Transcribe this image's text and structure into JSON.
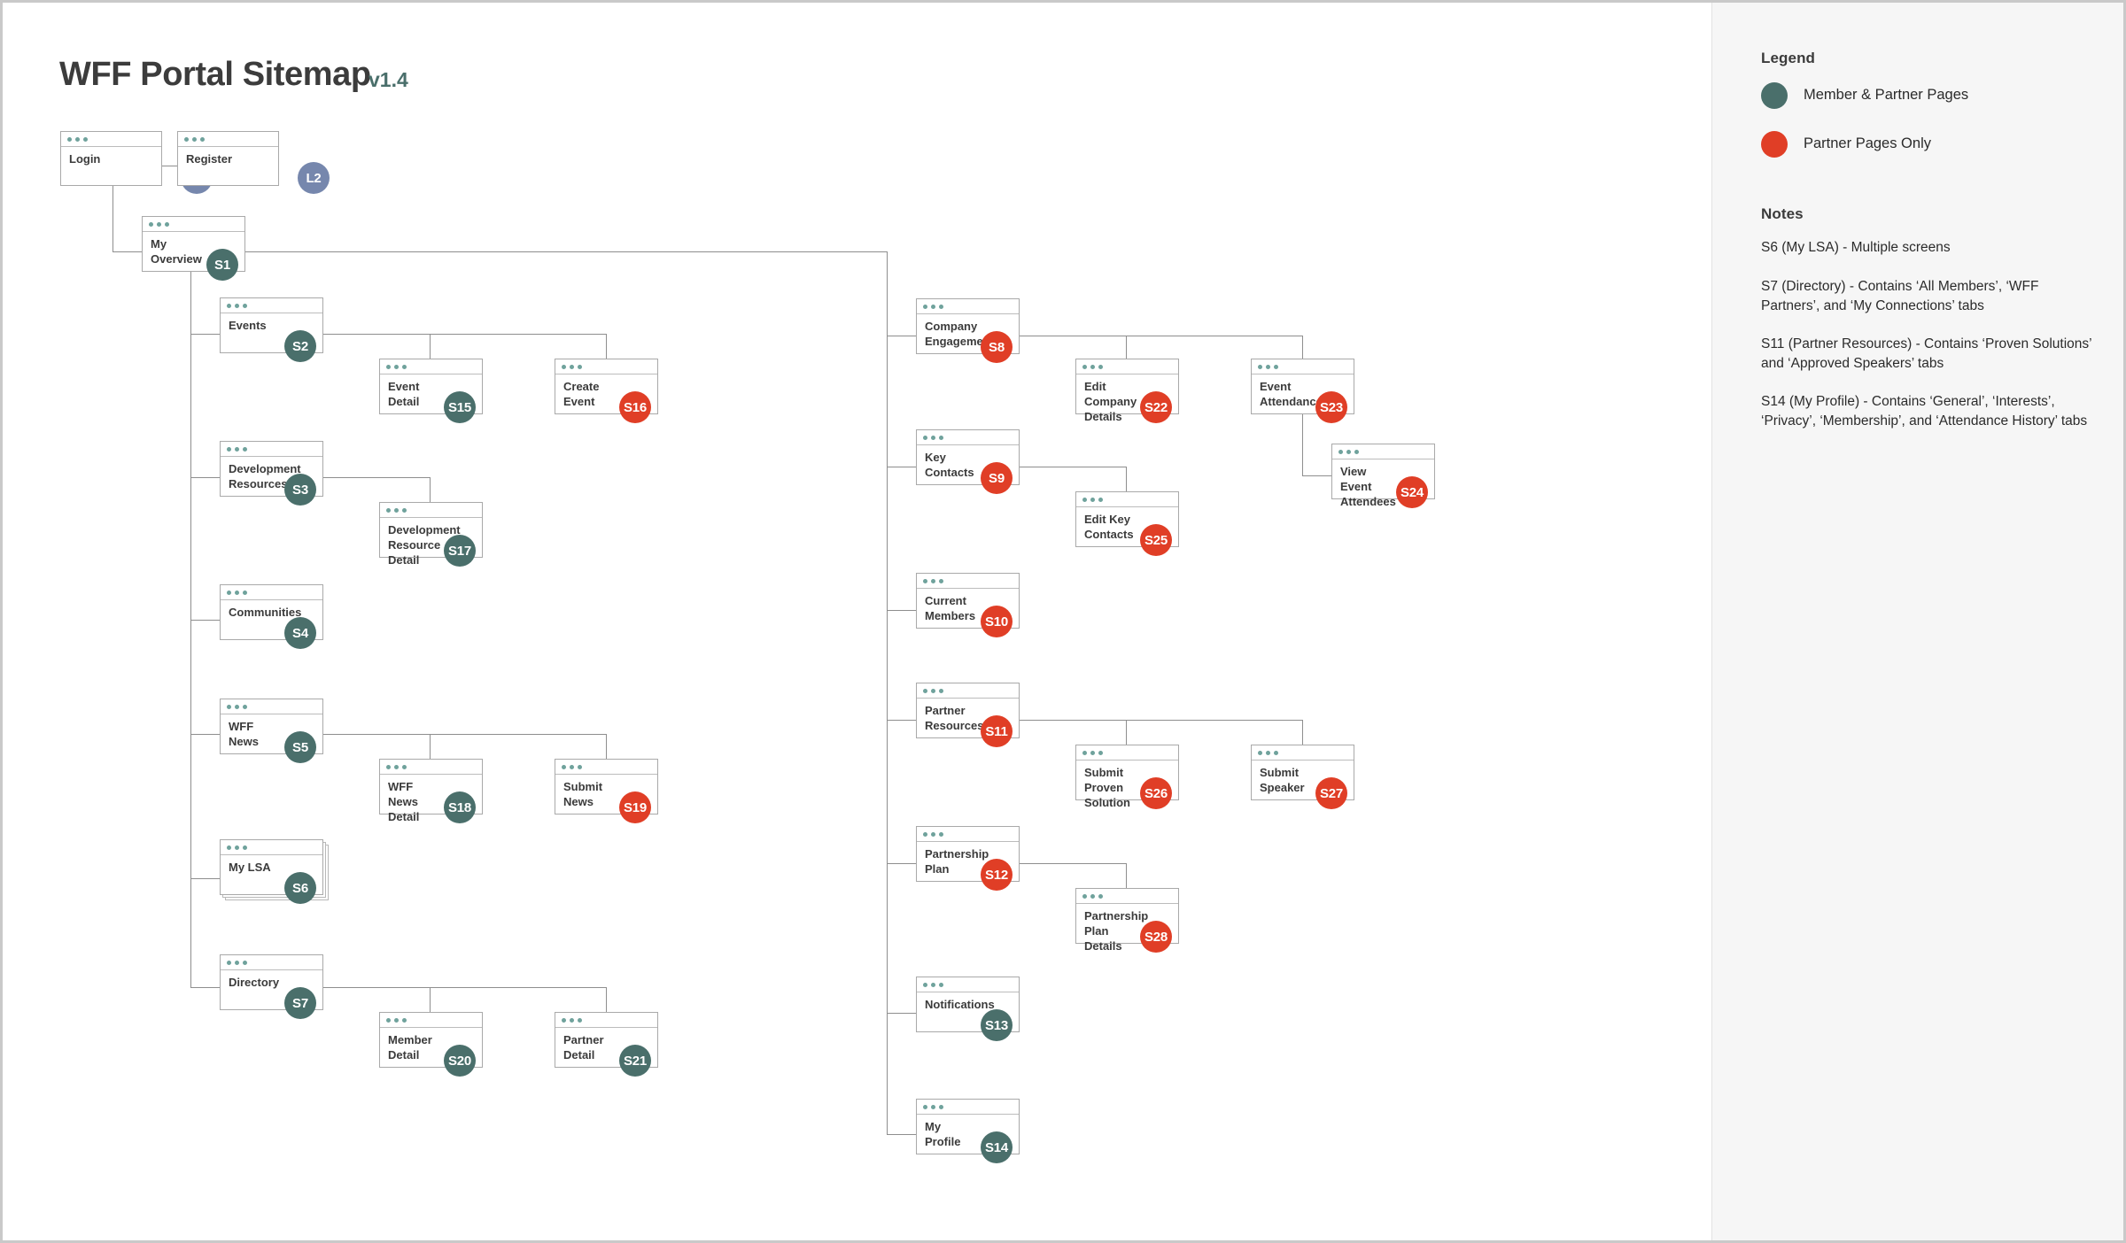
{
  "header": {
    "title": "WFF Portal Sitemap",
    "version": "v1.4"
  },
  "legend": {
    "heading": "Legend",
    "items": [
      {
        "label": "Member & Partner Pages",
        "color": "#4a6f6b",
        "icon": "teal-dot-icon"
      },
      {
        "label": "Partner Pages Only",
        "color": "#e03e26",
        "icon": "red-dot-icon"
      }
    ]
  },
  "notes": {
    "heading": "Notes",
    "items": [
      "S6 (My LSA) - Multiple screens",
      "S7 (Directory) - Contains ‘All Members’, ‘WFF Partners’, and ‘My Connections’ tabs",
      "S11 (Partner Resources) - Contains ‘Proven Solutions’ and ‘Approved Speakers’ tabs",
      "S14 (My Profile) - Contains ‘General’, ‘Interests’, ‘Privacy’, ‘Membership’, and ‘Attendance History’ tabs"
    ]
  },
  "nodes": [
    {
      "id": "L1",
      "label": "Login",
      "badge": "L1",
      "type": "slate"
    },
    {
      "id": "L2",
      "label": "Register",
      "badge": "L2",
      "type": "slate"
    },
    {
      "id": "S1",
      "label": "My Overview",
      "badge": "S1",
      "type": "teal"
    },
    {
      "id": "S2",
      "label": "Events",
      "badge": "S2",
      "type": "teal"
    },
    {
      "id": "S15",
      "label": "Event Detail",
      "badge": "S15",
      "type": "teal"
    },
    {
      "id": "S16",
      "label": "Create Event",
      "badge": "S16",
      "type": "red"
    },
    {
      "id": "S3",
      "label": "Development Resources",
      "badge": "S3",
      "type": "teal"
    },
    {
      "id": "S17",
      "label": "Development Resource Detail",
      "badge": "S17",
      "type": "teal"
    },
    {
      "id": "S4",
      "label": "Communities",
      "badge": "S4",
      "type": "teal"
    },
    {
      "id": "S5",
      "label": "WFF News",
      "badge": "S5",
      "type": "teal"
    },
    {
      "id": "S18",
      "label": "WFF News Detail",
      "badge": "S18",
      "type": "teal"
    },
    {
      "id": "S19",
      "label": "Submit News",
      "badge": "S19",
      "type": "red"
    },
    {
      "id": "S6",
      "label": "My LSA",
      "badge": "S6",
      "type": "teal"
    },
    {
      "id": "S7",
      "label": "Directory",
      "badge": "S7",
      "type": "teal"
    },
    {
      "id": "S20",
      "label": "Member Detail",
      "badge": "S20",
      "type": "teal"
    },
    {
      "id": "S21",
      "label": "Partner Detail",
      "badge": "S21",
      "type": "teal"
    },
    {
      "id": "S8",
      "label": "Company Engagement",
      "badge": "S8",
      "type": "red"
    },
    {
      "id": "S22",
      "label": "Edit Company Details",
      "badge": "S22",
      "type": "red"
    },
    {
      "id": "S23",
      "label": "Event Attendance",
      "badge": "S23",
      "type": "red"
    },
    {
      "id": "S24",
      "label": "View Event Attendees",
      "badge": "S24",
      "type": "red"
    },
    {
      "id": "S9",
      "label": "Key Contacts",
      "badge": "S9",
      "type": "red"
    },
    {
      "id": "S25",
      "label": "Edit Key Contacts",
      "badge": "S25",
      "type": "red"
    },
    {
      "id": "S10",
      "label": "Current Members",
      "badge": "S10",
      "type": "red"
    },
    {
      "id": "S11",
      "label": "Partner Resources",
      "badge": "S11",
      "type": "red"
    },
    {
      "id": "S26",
      "label": "Submit Proven Solution",
      "badge": "S26",
      "type": "red"
    },
    {
      "id": "S27",
      "label": "Submit Speaker",
      "badge": "S27",
      "type": "red"
    },
    {
      "id": "S12",
      "label": "Partnership Plan",
      "badge": "S12",
      "type": "red"
    },
    {
      "id": "S28",
      "label": "Partnership Plan Details",
      "badge": "S28",
      "type": "red"
    },
    {
      "id": "S13",
      "label": "Notifications",
      "badge": "S13",
      "type": "teal"
    },
    {
      "id": "S14",
      "label": "My Profile",
      "badge": "S14",
      "type": "teal"
    }
  ]
}
